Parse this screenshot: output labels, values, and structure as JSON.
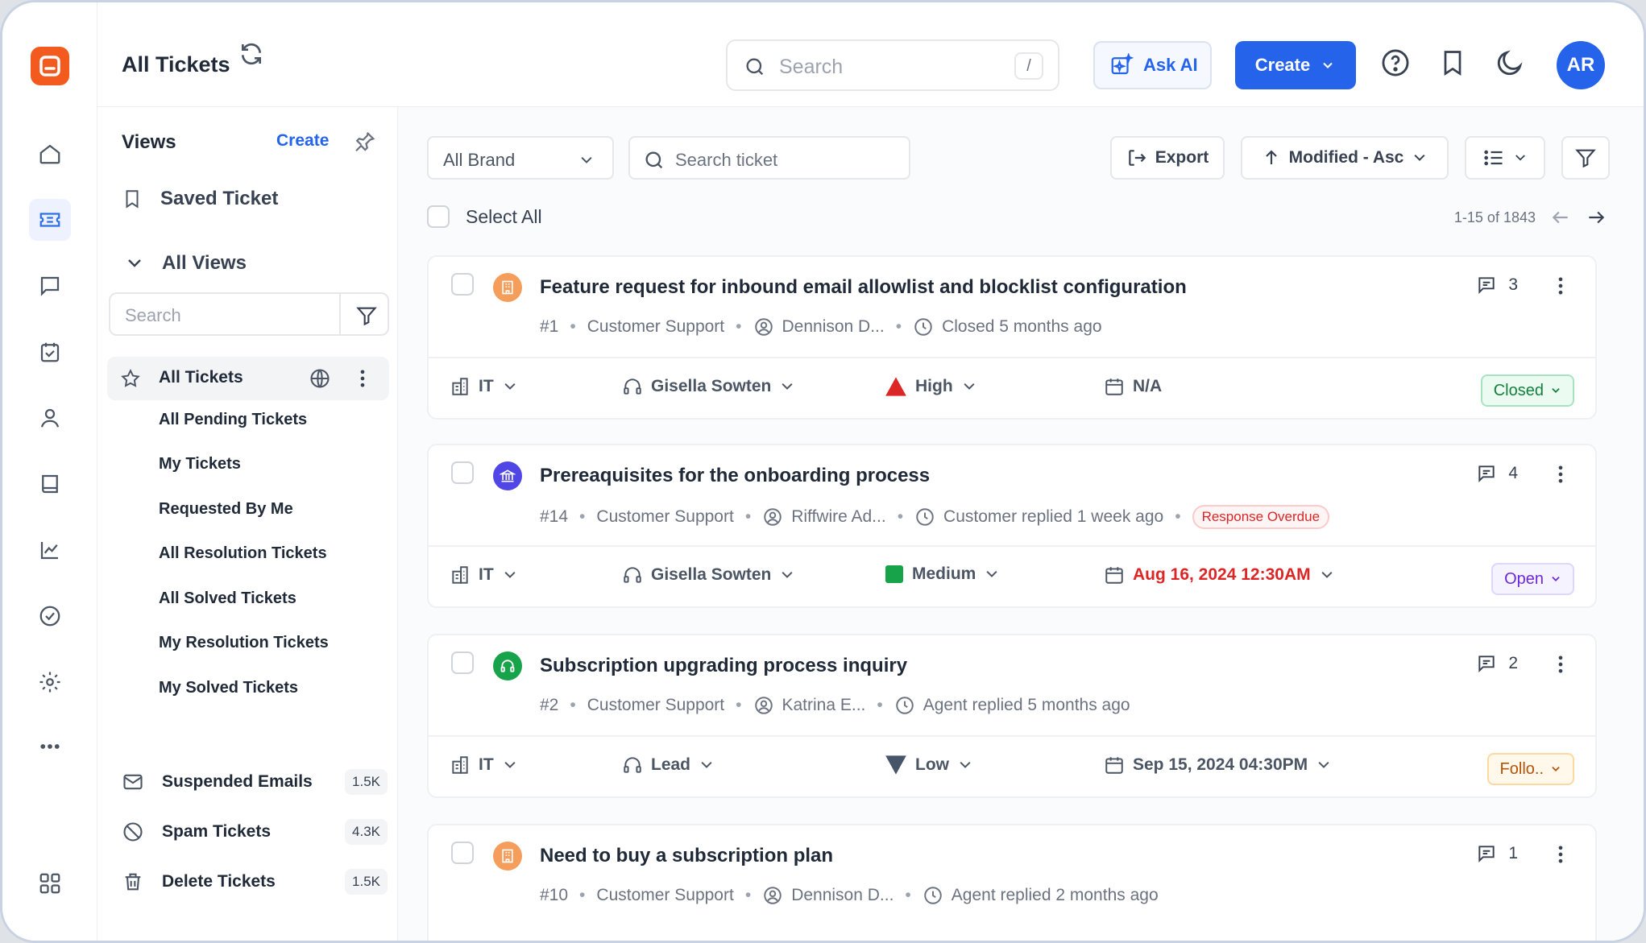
{
  "header": {
    "title": "All Tickets",
    "search_placeholder": "Search",
    "search_shortcut": "/",
    "ask_ai_label": "Ask AI",
    "create_label": "Create",
    "avatar_initials": "AR"
  },
  "views": {
    "title": "Views",
    "create_label": "Create",
    "saved_ticket_label": "Saved Ticket",
    "all_views_label": "All Views",
    "search_placeholder": "Search",
    "active_item": "All Tickets",
    "sub_items": [
      "All Pending Tickets",
      "My Tickets",
      "Requested By Me",
      "All Resolution Tickets",
      "All Solved Tickets",
      "My Resolution Tickets",
      "My Solved Tickets"
    ],
    "bottom_items": [
      {
        "label": "Suspended Emails",
        "count": "1.5K",
        "icon": "mail-icon"
      },
      {
        "label": "Spam Tickets",
        "count": "4.3K",
        "icon": "ban-icon"
      },
      {
        "label": "Delete Tickets",
        "count": "1.5K",
        "icon": "trash-icon"
      }
    ]
  },
  "toolbar": {
    "brand_value": "All Brand",
    "ticket_search_placeholder": "Search ticket",
    "export_label": "Export",
    "sort_label": "Modified - Asc",
    "select_all_label": "Select All",
    "pagination": "1-15 of 1843"
  },
  "tickets": [
    {
      "title": "Feature request for inbound email allowlist and blocklist configuration",
      "id": "#1",
      "team": "Customer Support",
      "requester": "Dennison D...",
      "activity": "Closed 5 months ago",
      "comments": "3",
      "department": "IT",
      "agent": "Gisella Sowten",
      "priority": "High",
      "due": "N/A",
      "status": "Closed",
      "icon_color": "#f59e5b",
      "icon": "building-icon"
    },
    {
      "title": "Prereaquisites for the onboarding process",
      "id": "#14",
      "team": "Customer Support",
      "requester": "Riffwire Ad...",
      "activity": "Customer replied 1 week ago",
      "flag": "Response Overdue",
      "comments": "4",
      "department": "IT",
      "agent": "Gisella Sowten",
      "priority": "Medium",
      "due": "Aug 16, 2024 12:30AM",
      "status": "Open",
      "icon_color": "#4f46e5",
      "icon": "bank-icon"
    },
    {
      "title": "Subscription upgrading process inquiry",
      "id": "#2",
      "team": "Customer Support",
      "requester": "Katrina E...",
      "activity": "Agent replied 5 months ago",
      "comments": "2",
      "department": "IT",
      "agent": "Lead",
      "priority": "Low",
      "due": "Sep 15, 2024 04:30PM",
      "status": "Follo..",
      "icon_color": "#16a34a",
      "icon": "headset-icon"
    },
    {
      "title": "Need to buy a subscription plan",
      "id": "#10",
      "team": "Customer Support",
      "requester": "Dennison D...",
      "activity": "Agent replied 2 months ago",
      "comments": "1",
      "icon_color": "#f59e5b",
      "icon": "building-icon"
    }
  ],
  "colors": {
    "accent": "#2563eb",
    "brand": "#f35a1d",
    "priority_high": "#dc2626",
    "priority_medium": "#16a34a",
    "priority_low": "#475569",
    "overdue": "#dc2626"
  }
}
